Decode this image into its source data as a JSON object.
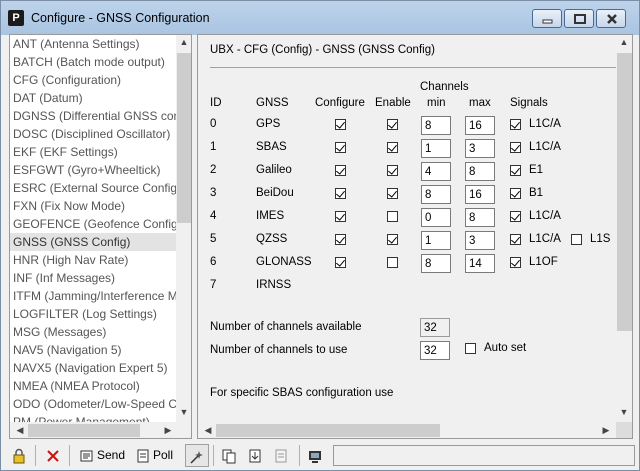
{
  "window": {
    "title": "Configure - GNSS Configuration",
    "app_icon_letter": "P"
  },
  "list": {
    "items": [
      "ANT (Antenna Settings)",
      "BATCH (Batch mode output)",
      "CFG (Configuration)",
      "DAT (Datum)",
      "DGNSS (Differential GNSS conf",
      "DOSC (Disciplined Oscillator)",
      "EKF (EKF Settings)",
      "ESFGWT (Gyro+Wheeltick)",
      "ESRC (External Source Config)",
      "FXN (Fix Now Mode)",
      "GEOFENCE (Geofence Config)",
      "GNSS (GNSS Config)",
      "HNR (High Nav Rate)",
      "INF (Inf Messages)",
      "ITFM (Jamming/Interference M",
      "LOGFILTER (Log Settings)",
      "MSG (Messages)",
      "NAV5 (Navigation 5)",
      "NAVX5 (Navigation Expert 5)",
      "NMEA (NMEA Protocol)",
      "ODO (Odometer/Low-Speed C",
      "PM (Power Management)"
    ],
    "selected_index": 11
  },
  "panel": {
    "title": "UBX - CFG (Config) - GNSS (GNSS Config)",
    "headers": {
      "id": "ID",
      "gnss": "GNSS",
      "configure": "Configure",
      "enable": "Enable",
      "channels": "Channels",
      "min": "min",
      "max": "max",
      "signals": "Signals"
    },
    "rows": [
      {
        "id": "0",
        "gnss": "GPS",
        "configure": true,
        "enable": true,
        "min": "8",
        "max": "16",
        "signals": [
          {
            "label": "L1C/A",
            "checked": true
          }
        ]
      },
      {
        "id": "1",
        "gnss": "SBAS",
        "configure": true,
        "enable": true,
        "min": "1",
        "max": "3",
        "signals": [
          {
            "label": "L1C/A",
            "checked": true
          }
        ]
      },
      {
        "id": "2",
        "gnss": "Galileo",
        "configure": true,
        "enable": true,
        "min": "4",
        "max": "8",
        "signals": [
          {
            "label": "E1",
            "checked": true
          }
        ]
      },
      {
        "id": "3",
        "gnss": "BeiDou",
        "configure": true,
        "enable": true,
        "min": "8",
        "max": "16",
        "signals": [
          {
            "label": "B1",
            "checked": true
          }
        ]
      },
      {
        "id": "4",
        "gnss": "IMES",
        "configure": true,
        "enable": false,
        "min": "0",
        "max": "8",
        "signals": [
          {
            "label": "L1C/A",
            "checked": true
          }
        ]
      },
      {
        "id": "5",
        "gnss": "QZSS",
        "configure": true,
        "enable": true,
        "min": "1",
        "max": "3",
        "signals": [
          {
            "label": "L1C/A",
            "checked": true
          },
          {
            "label": "L1S",
            "checked": false
          }
        ]
      },
      {
        "id": "6",
        "gnss": "GLONASS",
        "configure": true,
        "enable": false,
        "min": "8",
        "max": "14",
        "signals": [
          {
            "label": "L1OF",
            "checked": true
          }
        ]
      },
      {
        "id": "7",
        "gnss": "IRNSS",
        "configure": null,
        "enable": null,
        "min": null,
        "max": null,
        "signals": []
      }
    ],
    "channels_available_label": "Number of channels available",
    "channels_available": "32",
    "channels_to_use_label": "Number of channels to use",
    "channels_to_use": "32",
    "auto_set_label": "Auto set",
    "auto_set": false,
    "footer_text": "For specific SBAS configuration use"
  },
  "toolbar": {
    "send_label": "Send",
    "poll_label": "Poll"
  },
  "colors": {
    "titlebar": "#b3cbe6",
    "selected_row": "#e3e3e3"
  }
}
